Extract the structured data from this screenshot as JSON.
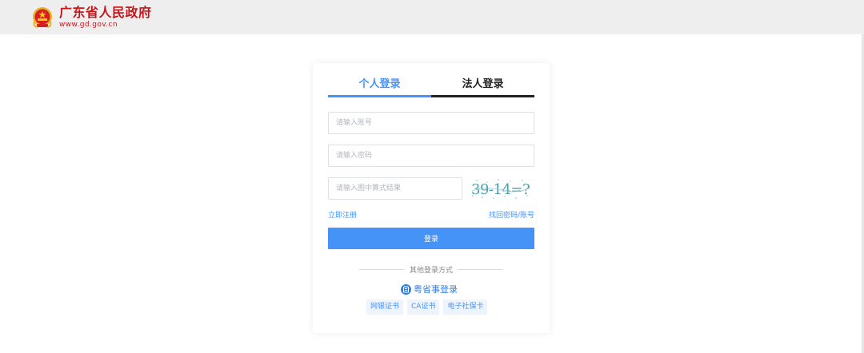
{
  "header": {
    "title": "广东省人民政府",
    "url": "www.gd.gov.cn",
    "emblem_icon": "national-emblem-icon",
    "brand_color": "#c8161d"
  },
  "login": {
    "tabs": [
      {
        "label": "个人登录",
        "active": true
      },
      {
        "label": "法人登录",
        "active": false
      }
    ],
    "account_placeholder": "请输入账号",
    "password_placeholder": "请输入密码",
    "captcha_placeholder": "请输入图中算式结果",
    "captcha_text": "39-14=?",
    "register_link": "立即注册",
    "forgot_link": "找回密码/账号",
    "submit_label": "登录",
    "accent_color": "#4593f7"
  },
  "other_methods": {
    "title": "其他登录方式",
    "ysd_label": "粤省事登录",
    "ysd_icon": "yueshengshi-icon",
    "options": [
      {
        "label": "网银证书"
      },
      {
        "label": "CA证书"
      },
      {
        "label": "电子社保卡"
      }
    ]
  }
}
